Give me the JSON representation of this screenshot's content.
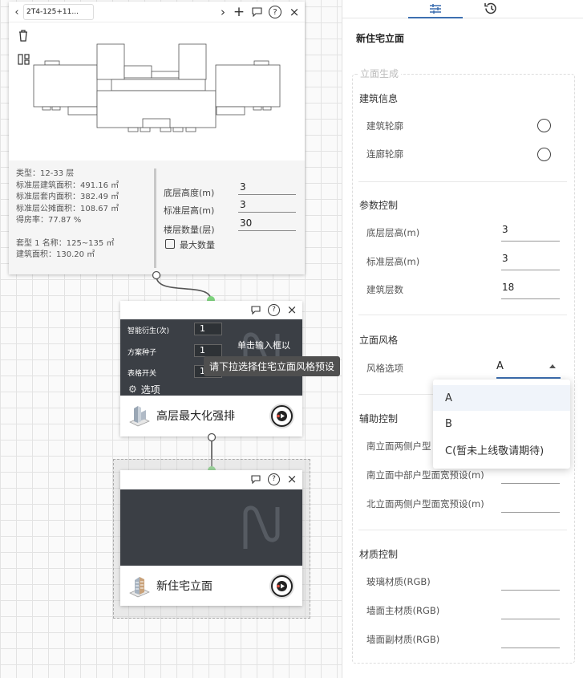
{
  "node1": {
    "tab_title": "2T4-125+11...",
    "info_lines": [
      "类型：12-33 层",
      "标准层建筑面积：491.16 ㎡",
      "标准层套内面积：382.49 ㎡",
      "标准层公摊面积：108.67 ㎡",
      "得房率：77.87 %"
    ],
    "info_lines2": [
      "套型 1 名称：125~135 ㎡",
      "建筑面积：130.20 ㎡"
    ],
    "fields": [
      {
        "label": "底层高度(m)",
        "value": "3"
      },
      {
        "label": "标准层高(m)",
        "value": "3"
      },
      {
        "label": "楼层数量(层)",
        "value": "30"
      }
    ],
    "max_floor_label": "最大数量"
  },
  "node2": {
    "rows": [
      {
        "label": "智能衍生(次)",
        "value": "1"
      },
      {
        "label": "方案种子",
        "value": "1"
      },
      {
        "label": "表格开关",
        "value": "1"
      }
    ],
    "hint": "单击输入框以",
    "options_label": "选项",
    "title": "高层最大化强排"
  },
  "tooltip": "请下拉选择住宅立面风格预设",
  "node3": {
    "title": "新住宅立面"
  },
  "panel": {
    "heading": "新住宅立面",
    "group_title": "立面生成",
    "building_info": "建筑信息",
    "building_outline": "建筑轮廓",
    "corridor_outline": "连廊轮廓",
    "param_control": "参数控制",
    "ground_height": {
      "label": "底层层高(m)",
      "value": "3"
    },
    "std_height": {
      "label": "标准层高(m)",
      "value": "3"
    },
    "floors": {
      "label": "建筑层数",
      "value": "18"
    },
    "facade_style": "立面风格",
    "style_option": {
      "label": "风格选项",
      "value": "A"
    },
    "aux_control": "辅助控制",
    "aux_items": [
      "南立面两侧户型",
      "南立面中部户型面宽预设(m)",
      "北立面两侧户型面宽预设(m)"
    ],
    "material_control": "材质控制",
    "materials": [
      "玻璃材质(RGB)",
      "墙面主材质(RGB)",
      "墙面副材质(RGB)"
    ]
  },
  "dropdown": {
    "options": [
      "A",
      "B",
      "C(暂未上线敬请期待)"
    ],
    "selected": "A"
  },
  "colors": {
    "accent": "#3d6fb0",
    "port": "#7ed37e",
    "dark": "#3b3f45"
  }
}
